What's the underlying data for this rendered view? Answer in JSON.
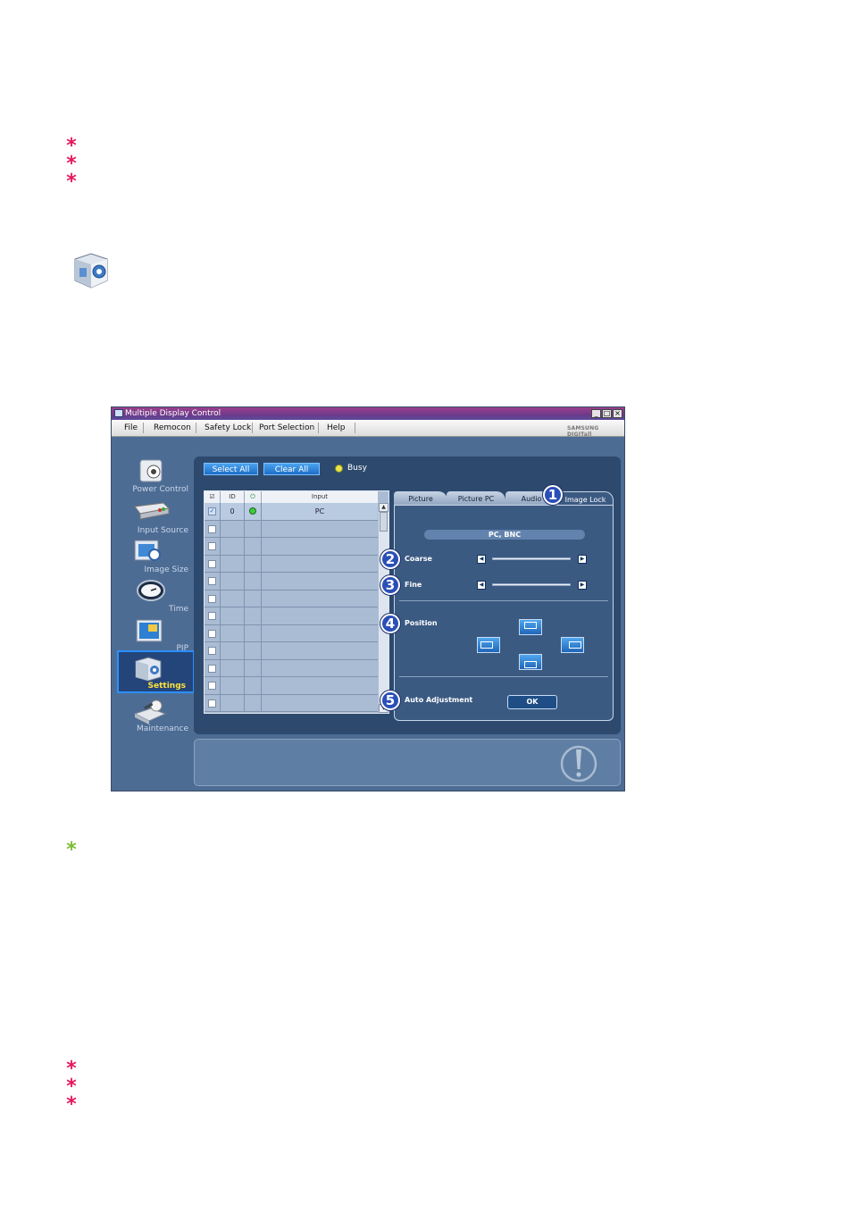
{
  "window": {
    "title": "Multiple Display Control",
    "brand": "SAMSUNG DIGITall",
    "controls": {
      "minimize": "_",
      "maximize": "□",
      "close": "×"
    }
  },
  "menu": {
    "items": [
      "File",
      "Remocon",
      "Safety Lock",
      "Port Selection",
      "Help"
    ]
  },
  "sidebar": {
    "items": [
      {
        "label": "Power Control",
        "icon": "power-control-icon"
      },
      {
        "label": "Input Source",
        "icon": "input-source-icon"
      },
      {
        "label": "Image Size",
        "icon": "image-size-icon"
      },
      {
        "label": "Time",
        "icon": "time-icon"
      },
      {
        "label": "PIP",
        "icon": "pip-icon"
      },
      {
        "label": "Settings",
        "icon": "settings-icon",
        "active": true
      },
      {
        "label": "Maintenance",
        "icon": "maintenance-icon"
      }
    ]
  },
  "toolbar": {
    "select_all": "Select All",
    "clear_all": "Clear All",
    "busy_label": "Busy"
  },
  "grid": {
    "headers": {
      "check": "☑",
      "id": "ID",
      "status": "⏻",
      "input": "Input"
    },
    "rows": [
      {
        "checked": true,
        "id": "0",
        "status": "on",
        "input": "PC"
      },
      {
        "checked": false,
        "id": "",
        "status": "",
        "input": ""
      },
      {
        "checked": false,
        "id": "",
        "status": "",
        "input": ""
      },
      {
        "checked": false,
        "id": "",
        "status": "",
        "input": ""
      },
      {
        "checked": false,
        "id": "",
        "status": "",
        "input": ""
      },
      {
        "checked": false,
        "id": "",
        "status": "",
        "input": ""
      },
      {
        "checked": false,
        "id": "",
        "status": "",
        "input": ""
      },
      {
        "checked": false,
        "id": "",
        "status": "",
        "input": ""
      },
      {
        "checked": false,
        "id": "",
        "status": "",
        "input": ""
      },
      {
        "checked": false,
        "id": "",
        "status": "",
        "input": ""
      },
      {
        "checked": false,
        "id": "",
        "status": "",
        "input": ""
      },
      {
        "checked": false,
        "id": "",
        "status": "",
        "input": ""
      }
    ]
  },
  "tabs": [
    "Picture",
    "Picture PC",
    "Audio",
    "Image Lock"
  ],
  "image_lock": {
    "source": "PC, BNC",
    "coarse": "Coarse",
    "fine": "Fine",
    "position": "Position",
    "auto_adjustment": "Auto Adjustment",
    "ok": "OK"
  },
  "callouts": [
    "1",
    "2",
    "3",
    "4",
    "5"
  ],
  "colors": {
    "pink_star": "#e5185f",
    "green_star": "#7dbb35",
    "window_bg": "#4d6c94",
    "accent": "#2b8fff"
  }
}
